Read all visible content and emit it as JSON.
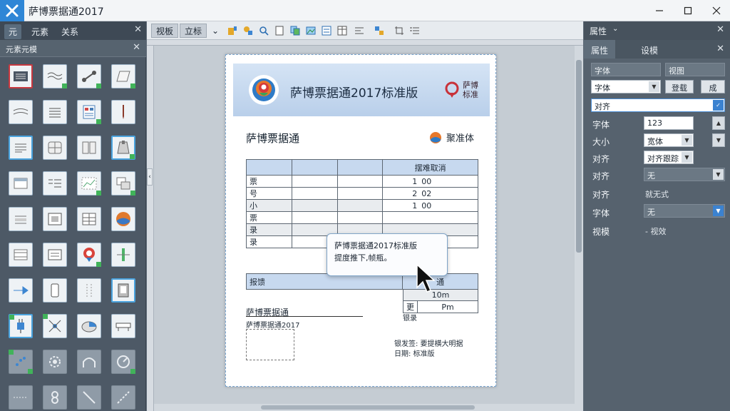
{
  "window": {
    "title": "萨博票据通2017"
  },
  "left_panel": {
    "tabs": [
      "元",
      "元素",
      "关系"
    ],
    "subpanel_title": "元素元模"
  },
  "toolbar": {
    "tabs": [
      "视板",
      "立标"
    ]
  },
  "document": {
    "banner_title": "萨博票据通2017标准版",
    "banner_badge_line1": "萨博",
    "banner_badge_line2": "标准",
    "heading": "萨博票据通",
    "brand_text": "聚准体",
    "table_header": "摆难取消",
    "rows": [
      {
        "label": "票",
        "num": "1",
        "val": "00"
      },
      {
        "label": "号",
        "num": "2",
        "val": "02"
      },
      {
        "label": "小",
        "num": "1",
        "val": "00"
      },
      {
        "label": "票",
        "num": "",
        "val": ""
      },
      {
        "label": "录",
        "num": "",
        "val": ""
      },
      {
        "label": "录",
        "num": "",
        "val": ""
      }
    ],
    "tooltip_line1": "萨博票据通2017标准版",
    "tooltip_line2": "提度推下,帧瓶。",
    "section2_label": "报馈",
    "section2_header": "通",
    "section2_row1": "10m",
    "section2_row2_label": "更",
    "section2_row2_value": "Pm",
    "section2_note": "银录",
    "signature_label": "萨博票据通",
    "signature_sub": "萨博票据通2017",
    "footer_line1": "银发签: 要提横大明据",
    "footer_line2": "日期: 标准版"
  },
  "right_panel": {
    "title": "属性",
    "tabs": [
      "属性",
      "设模"
    ],
    "top_field1": "字体",
    "top_field2": "视图",
    "font_select": "字体",
    "btn1": "登载",
    "btn2": "成",
    "align_select": "对齐",
    "props": [
      {
        "label": "字体",
        "value": "123"
      },
      {
        "label": "大小",
        "value": "宽体"
      },
      {
        "label": "对齐",
        "value": "对齐跟踪"
      },
      {
        "label": "对齐",
        "value": "无"
      },
      {
        "label": "对齐",
        "value": "就无式"
      },
      {
        "label": "字体",
        "value": "无"
      },
      {
        "label": "视模",
        "value": "- 视效"
      }
    ]
  }
}
